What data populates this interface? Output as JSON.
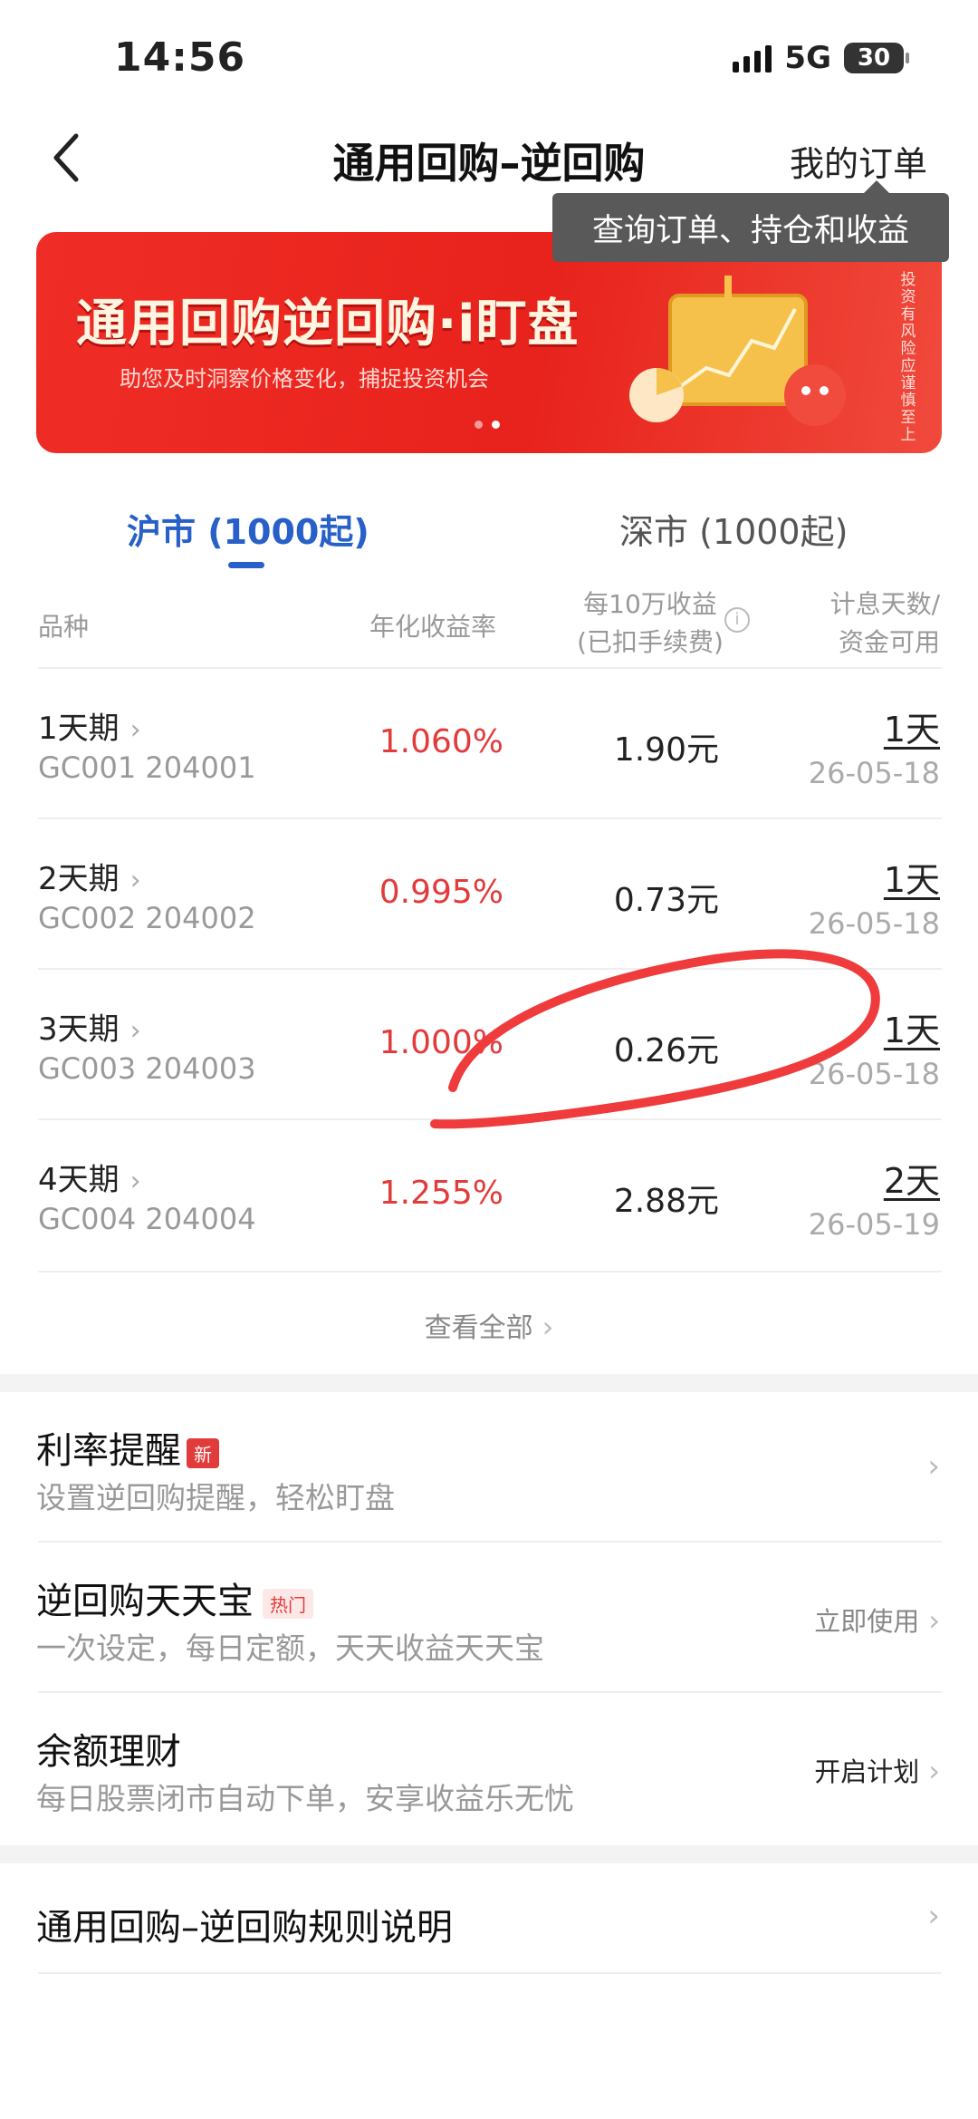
{
  "status": {
    "time": "14:56",
    "network": "5G",
    "battery": "30"
  },
  "nav": {
    "title": "通用回购–逆回购",
    "my_orders": "我的订单",
    "tooltip": "查询订单、持仓和收益"
  },
  "banner": {
    "title": "通用回购逆回购·i盯盘",
    "subtitle": "助您及时洞察价格变化，捕捉投资机会",
    "risk_note": "投资有风险 应谨慎至上"
  },
  "tabs": [
    {
      "label": "沪市 (1000起)",
      "active": true
    },
    {
      "label": "深市 (1000起)",
      "active": false
    }
  ],
  "table": {
    "headers": {
      "name": "品种",
      "rate": "年化收益率",
      "earn_line1": "每10万收益",
      "earn_line2": "(已扣手续费)",
      "days_line1": "计息天数/",
      "days_line2": "资金可用"
    },
    "rows": [
      {
        "name": "1天期",
        "code": "GC001 204001",
        "rate": "1.060%",
        "earn": "1.90元",
        "days": "1天",
        "date": "26-05-18"
      },
      {
        "name": "2天期",
        "code": "GC002 204002",
        "rate": "0.995%",
        "earn": "0.73元",
        "days": "1天",
        "date": "26-05-18"
      },
      {
        "name": "3天期",
        "code": "GC003 204003",
        "rate": "1.000%",
        "earn": "0.26元",
        "days": "1天",
        "date": "26-05-18"
      },
      {
        "name": "4天期",
        "code": "GC004 204004",
        "rate": "1.255%",
        "earn": "2.88元",
        "days": "2天",
        "date": "26-05-19"
      }
    ],
    "view_all": "查看全部"
  },
  "features": [
    {
      "title": "利率提醒",
      "badge": "新",
      "subtitle": "设置逆回购提醒，轻松盯盘",
      "action": ""
    },
    {
      "title": "逆回购天天宝",
      "badge": "热门",
      "subtitle": "一次设定，每日定额，天天收益天天宝",
      "action": "立即使用"
    },
    {
      "title": "余额理财",
      "badge": "",
      "subtitle": "每日股票闭市自动下单，安享收益乐无忧",
      "action": "开启计划"
    }
  ],
  "rules_link": "通用回购–逆回购规则说明",
  "colors": {
    "accent_blue": "#2760c8",
    "rate_red": "#e23b3b",
    "banner_red": "#e8221c"
  }
}
